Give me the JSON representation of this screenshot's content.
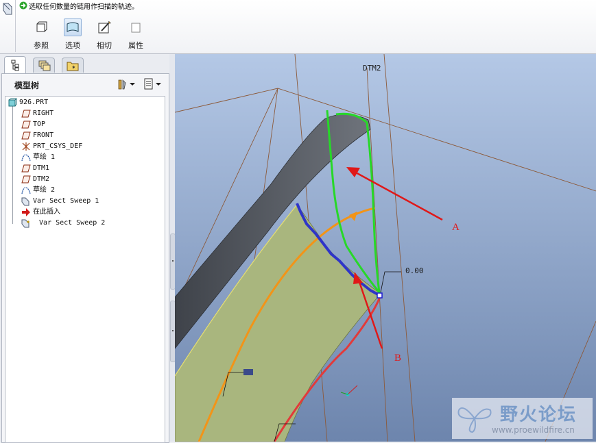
{
  "dashboard": {
    "prompt": "选取任何数量的链用作扫描的轨迹。",
    "tabs": [
      {
        "label": "参照",
        "icon": "reference-box-icon"
      },
      {
        "label": "选项",
        "icon": "options-surface-icon"
      },
      {
        "label": "相切",
        "icon": "tangency-icon"
      },
      {
        "label": "属性",
        "icon": "properties-icon"
      }
    ],
    "active_tab": "选项"
  },
  "model_tree": {
    "title": "模型树",
    "items": [
      {
        "label": "926.PRT",
        "icon": "part-icon"
      },
      {
        "label": "RIGHT",
        "icon": "datum-plane-icon"
      },
      {
        "label": "TOP",
        "icon": "datum-plane-icon"
      },
      {
        "label": "FRONT",
        "icon": "datum-plane-icon"
      },
      {
        "label": "PRT_CSYS_DEF",
        "icon": "coordinate-system-icon"
      },
      {
        "label": "草绘 1",
        "icon": "sketch-icon"
      },
      {
        "label": "DTM1",
        "icon": "datum-plane-icon"
      },
      {
        "label": "DTM2",
        "icon": "datum-plane-icon"
      },
      {
        "label": "草绘 2",
        "icon": "sketch-icon"
      },
      {
        "label": "Var Sect Sweep 1",
        "icon": "sweep-feature-icon"
      },
      {
        "label": "在此插入",
        "icon": "insert-here-arrow-icon"
      },
      {
        "label": "Var Sect Sweep 2",
        "icon": "sweep-feature-new-icon"
      }
    ]
  },
  "viewport": {
    "datum_label": "DTM2",
    "dimension_value": "0.00",
    "annotation_a": "A",
    "annotation_b": "B",
    "watermark_cn": "野火论坛",
    "watermark_url": "www.proewildfire.cn"
  },
  "colors": {
    "viewport_top": "#b4c8e6",
    "viewport_bottom": "#6d85ad",
    "surface_fill": "#a9b67e",
    "swept_surface": "#5d6169",
    "green_sketch": "#27d828",
    "blue_trajectory": "#2f35c8",
    "orange_curve": "#f29418",
    "red_curve": "#e23a3a",
    "annotation_red": "#e01818"
  }
}
